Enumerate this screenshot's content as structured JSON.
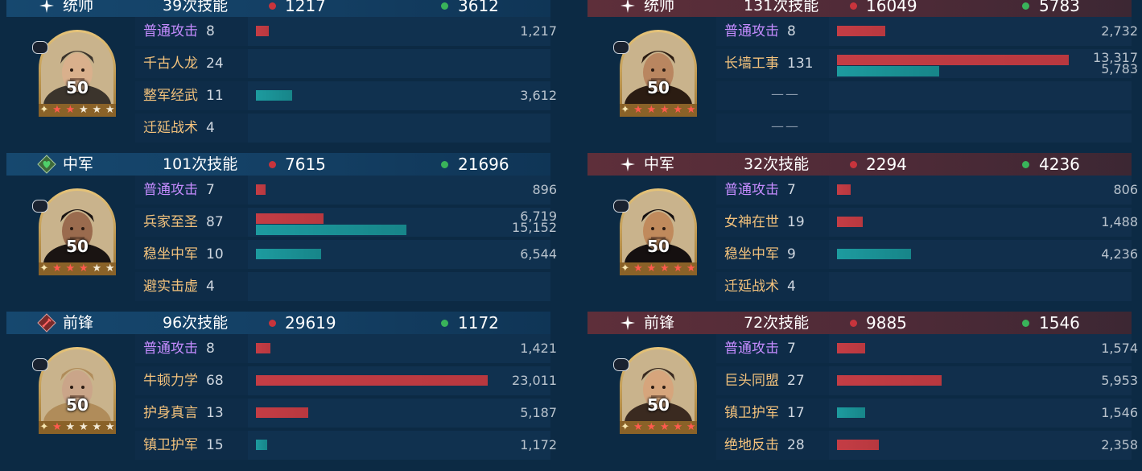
{
  "colors": {
    "red": "#c43d45",
    "teal": "#1d9b9f",
    "attack": "#c58cff",
    "skill": "#f3c27c"
  },
  "left": {
    "units": [
      {
        "role": "统帅",
        "role_icon": "star-icon",
        "skills": "39次技能",
        "damage": "1217",
        "heal": "3612",
        "level": "50",
        "stars_red": 2,
        "stars_total": 5,
        "rows": [
          {
            "name": "普通攻击",
            "count": "8",
            "attack": true,
            "red": 0.057,
            "teal": 0,
            "vals": [
              "1,217"
            ]
          },
          {
            "name": "千古人龙",
            "count": "24",
            "attack": false,
            "red": 0,
            "teal": 0,
            "vals": []
          },
          {
            "name": "整军经武",
            "count": "11",
            "attack": false,
            "red": 0,
            "teal": 0.155,
            "vals": [
              "3,612"
            ]
          },
          {
            "name": "迁延战术",
            "count": "4",
            "attack": false,
            "red": 0,
            "teal": 0,
            "vals": []
          }
        ]
      },
      {
        "role": "中军",
        "role_icon": "heart-shield-icon",
        "skills": "101次技能",
        "damage": "7615",
        "heal": "21696",
        "level": "50",
        "stars_red": 3,
        "stars_total": 5,
        "rows": [
          {
            "name": "普通攻击",
            "count": "7",
            "attack": true,
            "red": 0.04,
            "teal": 0,
            "vals": [
              "896"
            ]
          },
          {
            "name": "兵家至圣",
            "count": "87",
            "attack": false,
            "red": 0.29,
            "teal": 0.65,
            "vals": [
              "6,719",
              "15,152"
            ]
          },
          {
            "name": "稳坐中军",
            "count": "10",
            "attack": false,
            "red": 0,
            "teal": 0.28,
            "vals": [
              "6,544"
            ]
          },
          {
            "name": "避实击虚",
            "count": "4",
            "attack": false,
            "red": 0,
            "teal": 0,
            "vals": []
          }
        ]
      },
      {
        "role": "前锋",
        "role_icon": "sword-shield-icon",
        "skills": "96次技能",
        "damage": "29619",
        "heal": "1172",
        "level": "50",
        "stars_red": 1,
        "stars_total": 5,
        "rows": [
          {
            "name": "普通攻击",
            "count": "8",
            "attack": true,
            "red": 0.062,
            "teal": 0,
            "vals": [
              "1,421"
            ]
          },
          {
            "name": "牛顿力学",
            "count": "68",
            "attack": false,
            "red": 1.0,
            "teal": 0,
            "vals": [
              "23,011"
            ]
          },
          {
            "name": "护身真言",
            "count": "13",
            "attack": false,
            "red": 0.225,
            "teal": 0,
            "vals": [
              "5,187"
            ]
          },
          {
            "name": "镇卫护军",
            "count": "15",
            "attack": false,
            "red": 0,
            "teal": 0.05,
            "vals": [
              "1,172"
            ]
          }
        ]
      }
    ]
  },
  "right": {
    "units": [
      {
        "role": "统帅",
        "role_icon": "star-icon",
        "skills": "131次技能",
        "damage": "16049",
        "heal": "5783",
        "level": "50",
        "stars_red": 5,
        "stars_total": 5,
        "rows": [
          {
            "name": "普通攻击",
            "count": "8",
            "attack": true,
            "red": 0.21,
            "teal": 0,
            "vals": [
              "2,732"
            ]
          },
          {
            "name": "长墙工事",
            "count": "131",
            "attack": false,
            "red": 1.0,
            "teal": 0.44,
            "vals": [
              "13,317",
              "5,783"
            ]
          },
          {
            "name": "",
            "count": "",
            "attack": false,
            "red": 0,
            "teal": 0,
            "vals": [],
            "dash": "——"
          },
          {
            "name": "",
            "count": "",
            "attack": false,
            "red": 0,
            "teal": 0,
            "vals": [],
            "dash": "——"
          }
        ]
      },
      {
        "role": "中军",
        "role_icon": "star-icon",
        "skills": "32次技能",
        "damage": "2294",
        "heal": "4236",
        "level": "50",
        "stars_red": 5,
        "stars_total": 5,
        "rows": [
          {
            "name": "普通攻击",
            "count": "7",
            "attack": true,
            "red": 0.06,
            "teal": 0,
            "vals": [
              "806"
            ]
          },
          {
            "name": "女神在世",
            "count": "19",
            "attack": false,
            "red": 0.11,
            "teal": 0,
            "vals": [
              "1,488"
            ]
          },
          {
            "name": "稳坐中军",
            "count": "9",
            "attack": false,
            "red": 0,
            "teal": 0.32,
            "vals": [
              "4,236"
            ]
          },
          {
            "name": "迁延战术",
            "count": "4",
            "attack": false,
            "red": 0,
            "teal": 0,
            "vals": []
          }
        ]
      },
      {
        "role": "前锋",
        "role_icon": "star-icon",
        "skills": "72次技能",
        "damage": "9885",
        "heal": "1546",
        "level": "50",
        "stars_red": 5,
        "stars_total": 5,
        "rows": [
          {
            "name": "普通攻击",
            "count": "7",
            "attack": true,
            "red": 0.12,
            "teal": 0,
            "vals": [
              "1,574"
            ]
          },
          {
            "name": "巨头同盟",
            "count": "27",
            "attack": false,
            "red": 0.45,
            "teal": 0,
            "vals": [
              "5,953"
            ]
          },
          {
            "name": "镇卫护军",
            "count": "17",
            "attack": false,
            "red": 0,
            "teal": 0.12,
            "vals": [
              "1,546"
            ]
          },
          {
            "name": "绝地反击",
            "count": "28",
            "attack": false,
            "red": 0.18,
            "teal": 0,
            "vals": [
              "2,358"
            ]
          }
        ]
      }
    ]
  }
}
